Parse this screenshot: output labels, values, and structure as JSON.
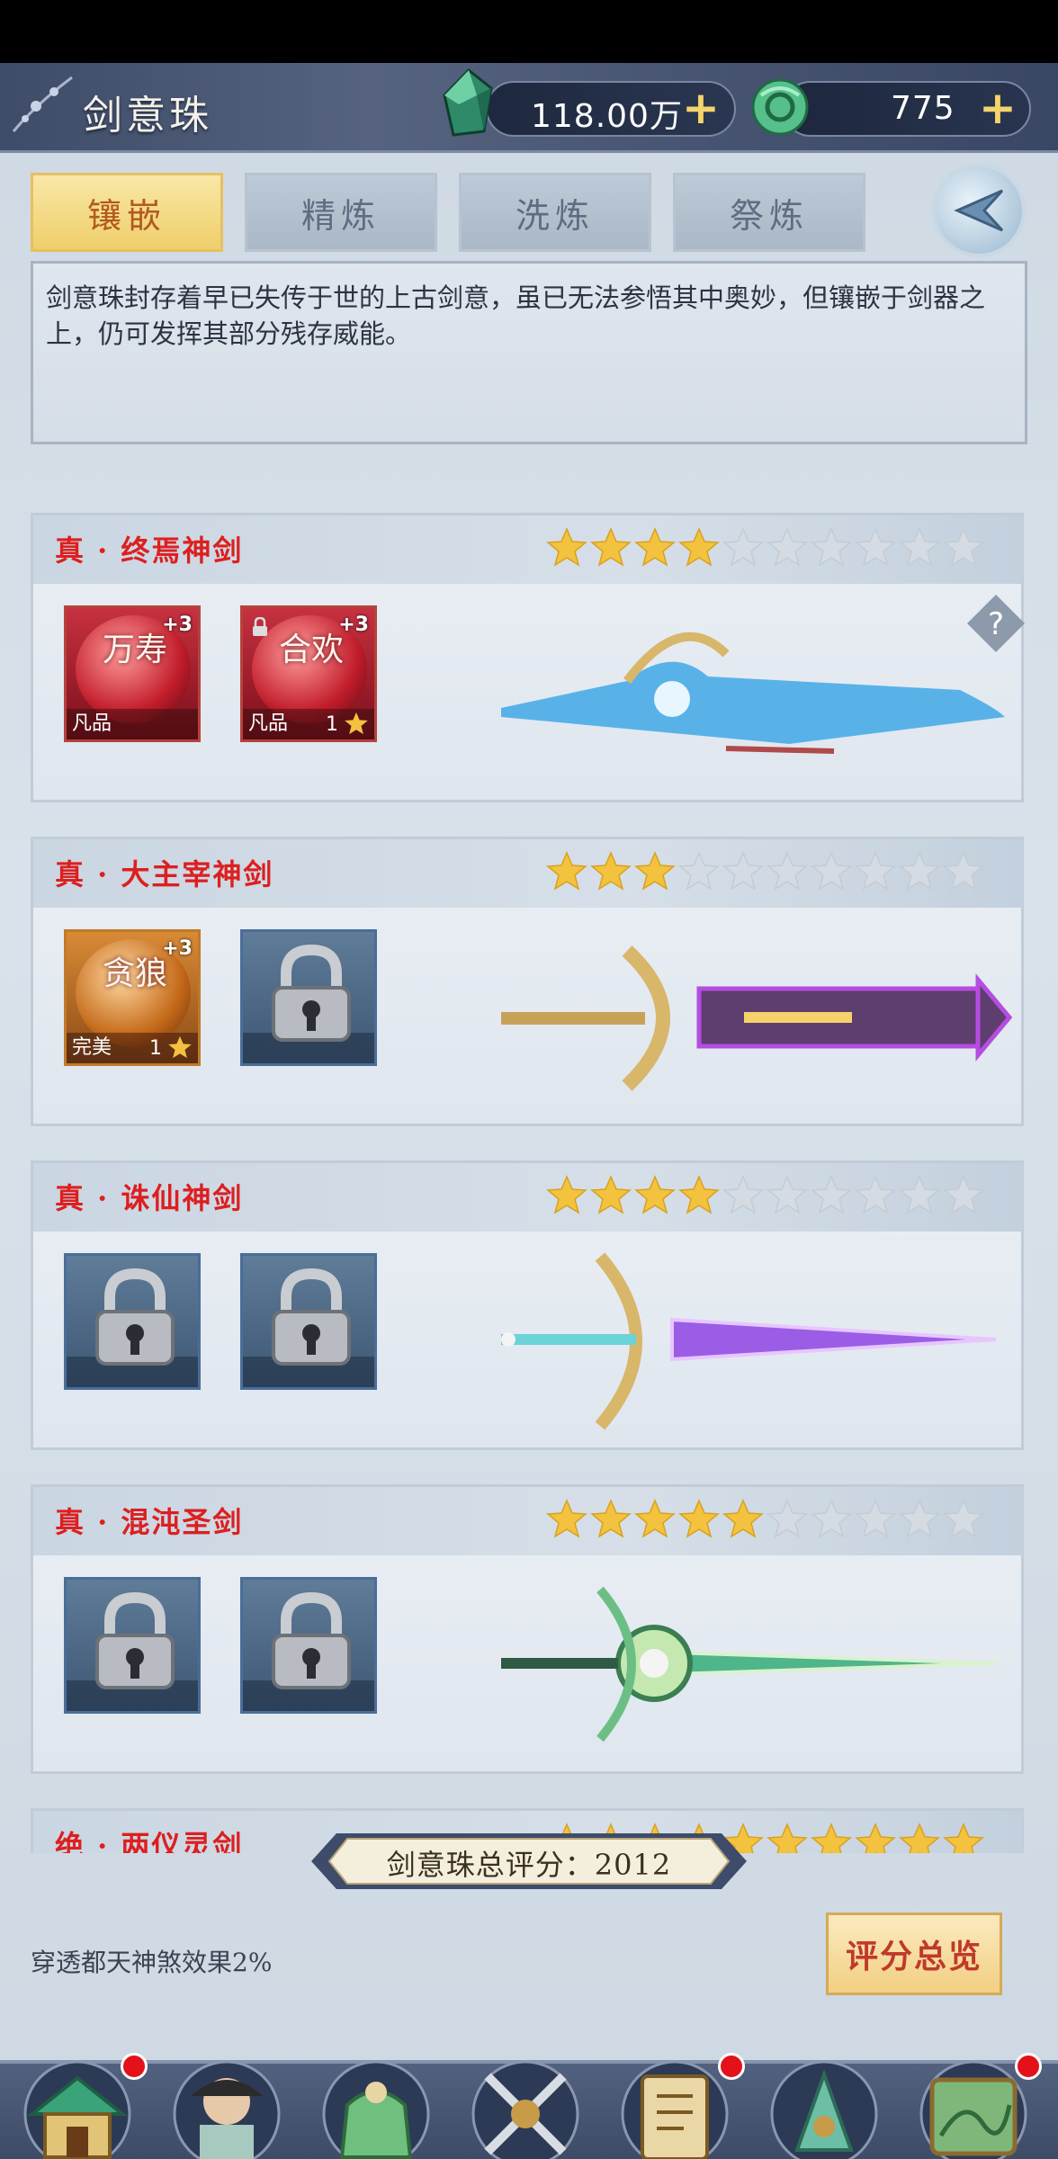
{
  "header": {
    "title": "剑意珠",
    "resources": [
      {
        "icon": "jade-crystal-icon",
        "value": "118.00万"
      },
      {
        "icon": "jade-coin-icon",
        "value": "775"
      }
    ]
  },
  "tabs": [
    {
      "label": "镶嵌",
      "active": true
    },
    {
      "label": "精炼",
      "active": false
    },
    {
      "label": "洗炼",
      "active": false
    },
    {
      "label": "祭炼",
      "active": false
    }
  ],
  "description": "剑意珠封存着早已失传于世的上古剑意，虽已无法参悟其中奥妙，但镶嵌于剑器之上，仍可发挥其部分残存威能。",
  "swords": [
    {
      "name": "真 · 终焉神剑",
      "stars": 4,
      "max_stars": 10,
      "slots": [
        {
          "type": "gem",
          "text": "万寿",
          "plus": "+3",
          "grade": "凡品",
          "level": "",
          "locked_mini": false
        },
        {
          "type": "gem",
          "text": "合欢",
          "plus": "+3",
          "grade": "凡品",
          "level": "1",
          "locked_mini": true
        }
      ],
      "accent": "#3fa8e6"
    },
    {
      "name": "真 · 大主宰神剑",
      "stars": 3,
      "max_stars": 10,
      "slots": [
        {
          "type": "gem",
          "text": "贪狼",
          "plus": "+3",
          "grade": "完美",
          "level": "1",
          "locked_mini": false,
          "gold": true
        },
        {
          "type": "locked"
        }
      ],
      "accent": "#b54de0"
    },
    {
      "name": "真 · 诛仙神剑",
      "stars": 4,
      "max_stars": 10,
      "slots": [
        {
          "type": "locked"
        },
        {
          "type": "locked"
        }
      ],
      "accent": "#9b5de5"
    },
    {
      "name": "真 · 混沌圣剑",
      "stars": 5,
      "max_stars": 10,
      "slots": [
        {
          "type": "locked"
        },
        {
          "type": "locked"
        }
      ],
      "accent": "#4fb58a"
    },
    {
      "name": "绝 · 两仪灵剑",
      "stars": 10,
      "max_stars": 10,
      "slots": [
        {
          "type": "locked"
        },
        {
          "type": "locked"
        }
      ],
      "accent": "#6aa0d0"
    }
  ],
  "score": {
    "label": "剑意珠总评分：2012"
  },
  "effect": "穿透都天神煞效果2%",
  "overview_button": "评分总览",
  "nav": [
    {
      "label": "洞府",
      "icon": "cave-mansion-icon",
      "badge": true
    },
    {
      "label": "角色",
      "icon": "character-icon",
      "badge": false
    },
    {
      "label": "背包",
      "icon": "bag-icon",
      "badge": false
    },
    {
      "label": "征服",
      "icon": "crossed-swords-icon",
      "badge": false
    },
    {
      "label": "招式",
      "icon": "scroll-icon",
      "badge": true
    },
    {
      "label": "剑器",
      "icon": "sword-forge-icon",
      "badge": false
    },
    {
      "label": "世界",
      "icon": "world-map-icon",
      "badge": true
    }
  ],
  "colors": {
    "accent_gold": "#f0cf6b",
    "title_red": "#dd1f1f",
    "star_gold": "#f3c23e",
    "star_empty": "#d5dbe2"
  }
}
